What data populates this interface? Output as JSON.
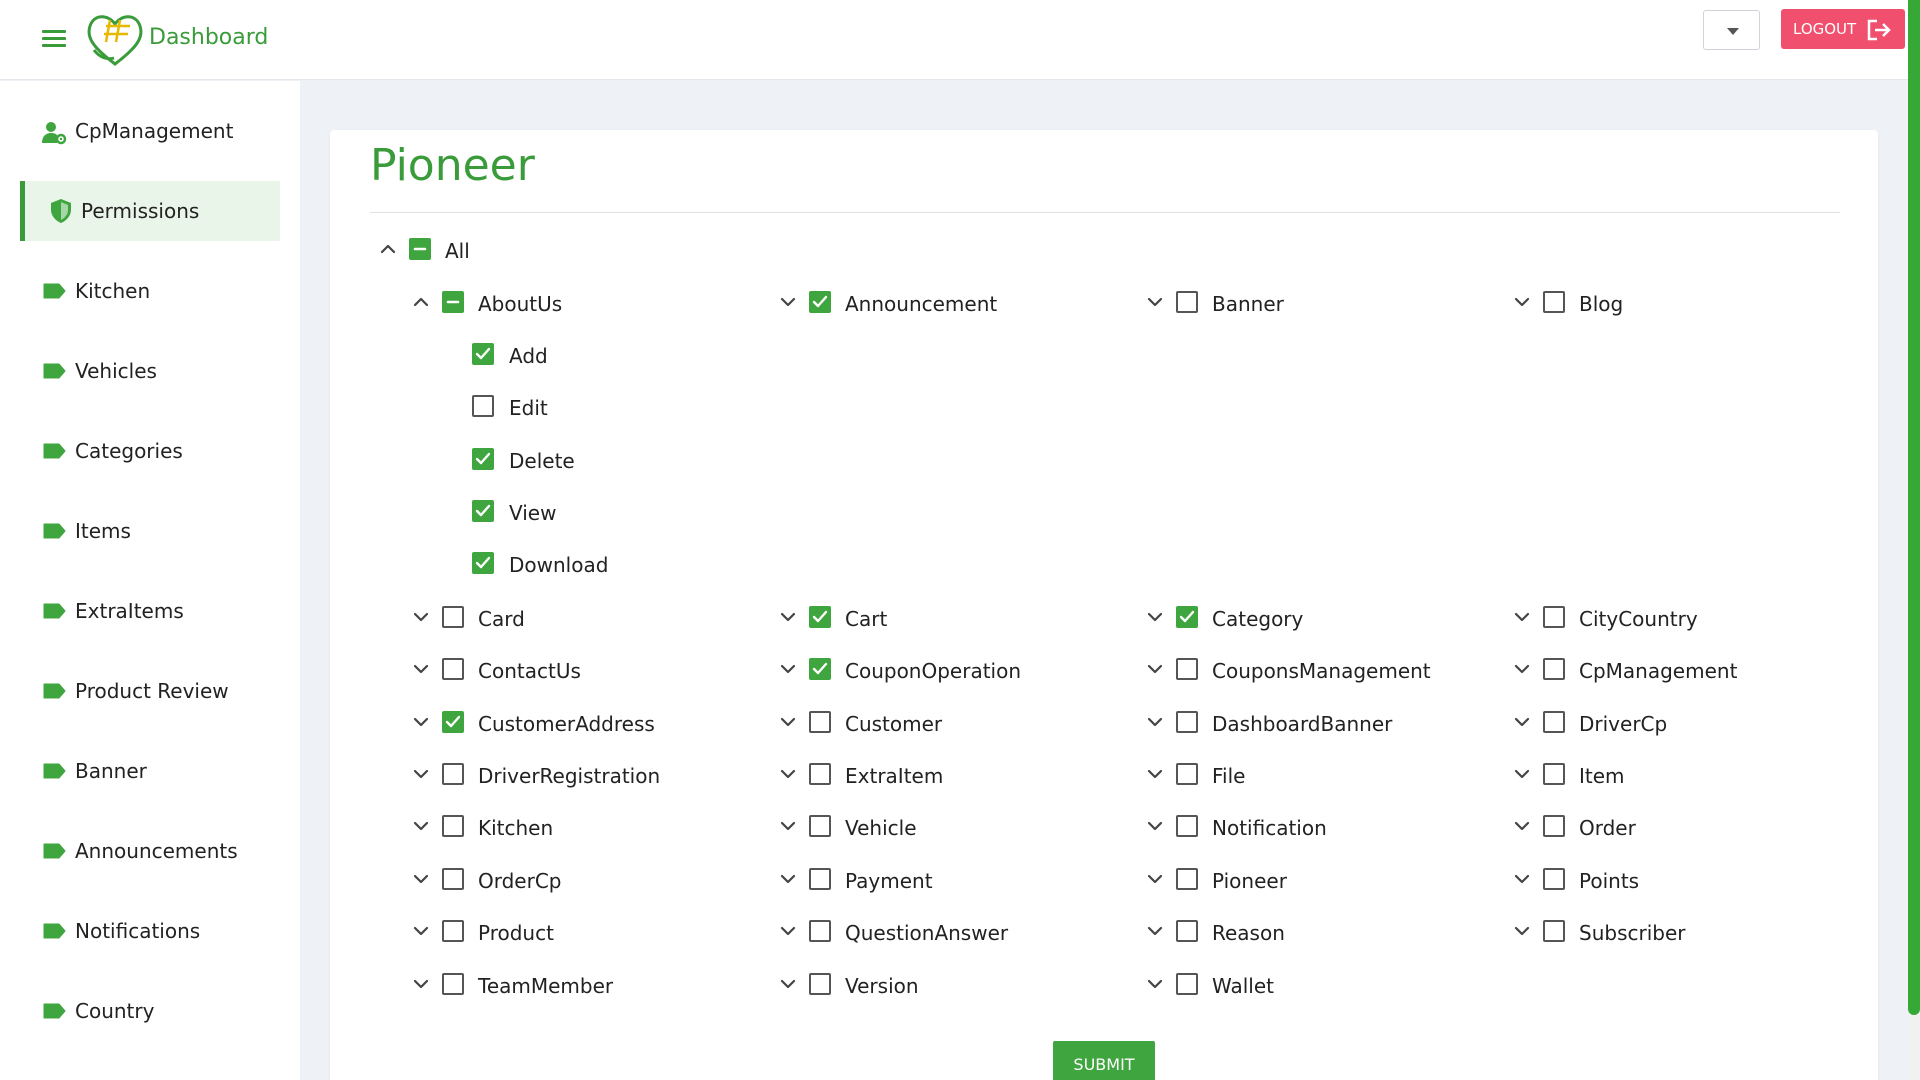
{
  "app": {
    "brand": "Dashboard",
    "logout_label": "LOGOUT"
  },
  "colors": {
    "accent": "#3a9b3a",
    "logout": "#f0506e",
    "checkbox": "#3fa53f"
  },
  "sidebar": {
    "items": [
      {
        "label": "CpManagement",
        "icon": "user-gear-icon",
        "active": false
      },
      {
        "label": "Permissions",
        "icon": "shield-icon",
        "active": true
      },
      {
        "label": "Kitchen",
        "icon": "tag-icon",
        "active": false
      },
      {
        "label": "Vehicles",
        "icon": "tag-icon",
        "active": false
      },
      {
        "label": "Categories",
        "icon": "tag-icon",
        "active": false
      },
      {
        "label": "Items",
        "icon": "tag-icon",
        "active": false
      },
      {
        "label": "ExtraItems",
        "icon": "tag-icon",
        "active": false
      },
      {
        "label": "Product Review",
        "icon": "tag-icon",
        "active": false
      },
      {
        "label": "Banner",
        "icon": "tag-icon",
        "active": false
      },
      {
        "label": "Announcements",
        "icon": "tag-icon",
        "active": false
      },
      {
        "label": "Notifications",
        "icon": "tag-icon",
        "active": false
      },
      {
        "label": "Country",
        "icon": "tag-icon",
        "active": false
      }
    ]
  },
  "permissions": {
    "title": "Pioneer",
    "root": {
      "label": "All",
      "state": "partial",
      "expanded": true
    },
    "expanded_group": {
      "label": "AboutUs",
      "state": "partial",
      "children": [
        {
          "label": "Add",
          "checked": true
        },
        {
          "label": "Edit",
          "checked": false
        },
        {
          "label": "Delete",
          "checked": true
        },
        {
          "label": "View",
          "checked": true
        },
        {
          "label": "Download",
          "checked": true
        }
      ]
    },
    "first_row_others": [
      {
        "label": "Announcement",
        "checked": true
      },
      {
        "label": "Banner",
        "checked": false
      },
      {
        "label": "Blog",
        "checked": false
      }
    ],
    "grid": [
      [
        {
          "label": "Card",
          "checked": false
        },
        {
          "label": "Cart",
          "checked": true
        },
        {
          "label": "Category",
          "checked": true
        },
        {
          "label": "CityCountry",
          "checked": false
        }
      ],
      [
        {
          "label": "ContactUs",
          "checked": false
        },
        {
          "label": "CouponOperation",
          "checked": true
        },
        {
          "label": "CouponsManagement",
          "checked": false
        },
        {
          "label": "CpManagement",
          "checked": false
        }
      ],
      [
        {
          "label": "CustomerAddress",
          "checked": true
        },
        {
          "label": "Customer",
          "checked": false
        },
        {
          "label": "DashboardBanner",
          "checked": false
        },
        {
          "label": "DriverCp",
          "checked": false
        }
      ],
      [
        {
          "label": "DriverRegistration",
          "checked": false
        },
        {
          "label": "ExtraItem",
          "checked": false
        },
        {
          "label": "File",
          "checked": false
        },
        {
          "label": "Item",
          "checked": false
        }
      ],
      [
        {
          "label": "Kitchen",
          "checked": false
        },
        {
          "label": "Vehicle",
          "checked": false
        },
        {
          "label": "Notification",
          "checked": false
        },
        {
          "label": "Order",
          "checked": false
        }
      ],
      [
        {
          "label": "OrderCp",
          "checked": false
        },
        {
          "label": "Payment",
          "checked": false
        },
        {
          "label": "Pioneer",
          "checked": false
        },
        {
          "label": "Points",
          "checked": false
        }
      ],
      [
        {
          "label": "Product",
          "checked": false
        },
        {
          "label": "QuestionAnswer",
          "checked": false
        },
        {
          "label": "Reason",
          "checked": false
        },
        {
          "label": "Subscriber",
          "checked": false
        }
      ],
      [
        {
          "label": "TeamMember",
          "checked": false
        },
        {
          "label": "Version",
          "checked": false
        },
        {
          "label": "Wallet",
          "checked": false
        }
      ]
    ],
    "submit_label": "SUBMIT"
  }
}
